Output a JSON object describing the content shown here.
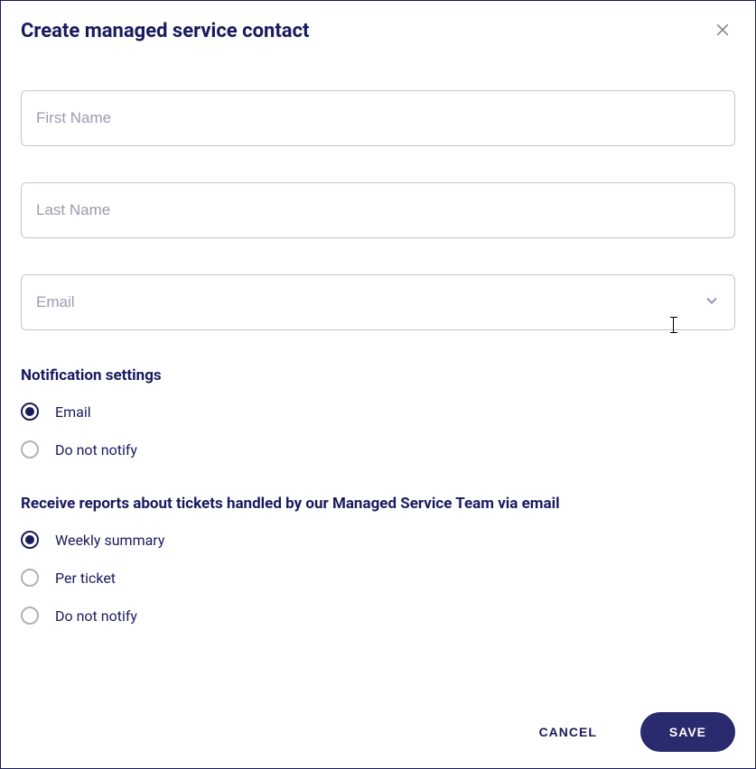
{
  "dialog": {
    "title": "Create managed service contact"
  },
  "fields": {
    "first_name": {
      "placeholder": "First Name",
      "value": ""
    },
    "last_name": {
      "placeholder": "Last Name",
      "value": ""
    },
    "email": {
      "placeholder": "Email",
      "value": ""
    }
  },
  "sections": {
    "notification": {
      "heading": "Notification settings",
      "options": [
        {
          "label": "Email",
          "selected": true
        },
        {
          "label": "Do not notify",
          "selected": false
        }
      ]
    },
    "reports": {
      "heading": "Receive reports about tickets handled by our Managed Service Team via email",
      "options": [
        {
          "label": "Weekly summary",
          "selected": true
        },
        {
          "label": "Per ticket",
          "selected": false
        },
        {
          "label": "Do not notify",
          "selected": false
        }
      ]
    }
  },
  "buttons": {
    "cancel": "CANCEL",
    "save": "SAVE"
  }
}
